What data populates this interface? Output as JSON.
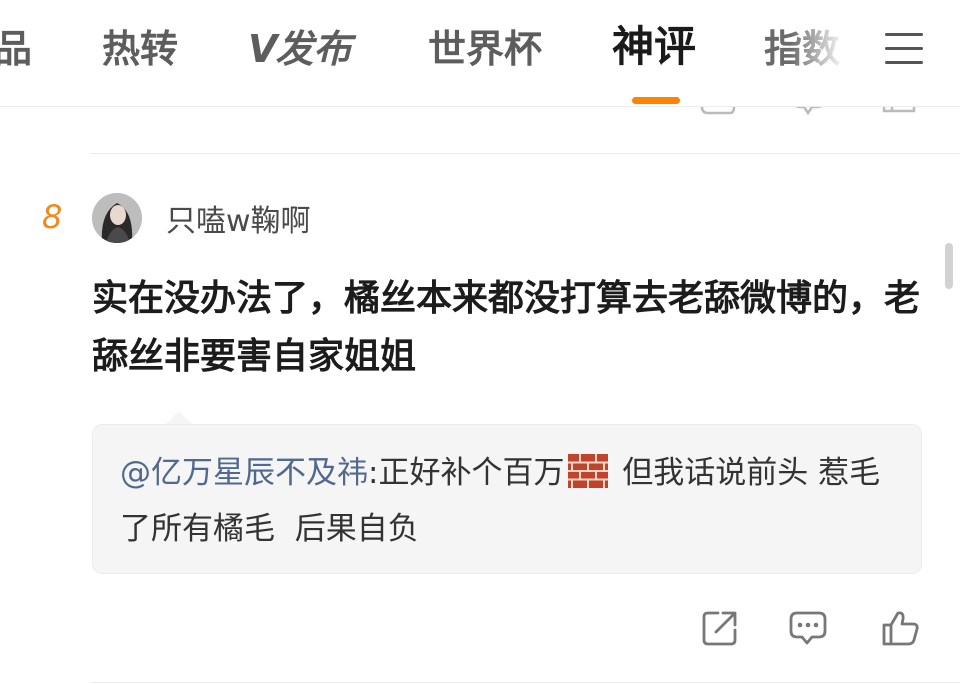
{
  "nav": {
    "tabs": [
      {
        "label": "品"
      },
      {
        "label": "热转"
      },
      {
        "label": "发布",
        "logo": "V"
      },
      {
        "label": "世界杯"
      },
      {
        "label": "神评"
      },
      {
        "label": "指数"
      }
    ],
    "active_tab": "神评",
    "menu_icon": "hamburger-menu-icon",
    "accent_color": "#ff8200"
  },
  "comment": {
    "rank": "8",
    "username": "只嗑w鞠啊",
    "text": "实在没办法了，橘丝本来都没打算去老舔微博的，老舔丝非要害自家姐姐",
    "reply": {
      "user": "@亿万星辰不及祎",
      "text_before": ":正好补个百万",
      "emoji": "brick-emoji",
      "text_after": " 但我话说前头 惹毛了所有橘毛  后果自负"
    },
    "actions": [
      "share-icon",
      "comment-icon",
      "like-icon"
    ]
  }
}
